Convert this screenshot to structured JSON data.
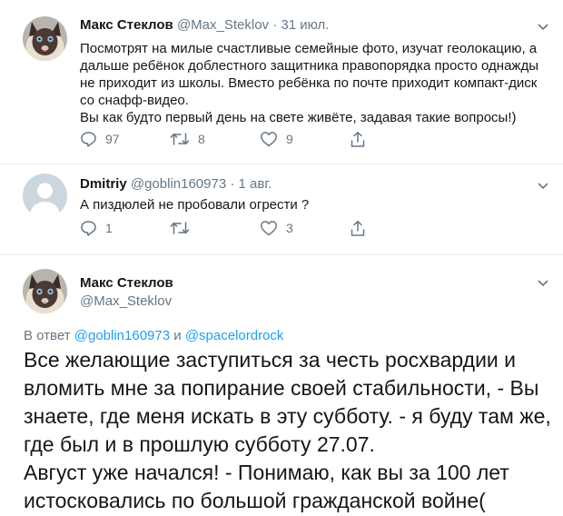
{
  "tweet1": {
    "name": "Макс Стеклов",
    "handle": "@Max_Steklov",
    "dot": "·",
    "date": "31 июл.",
    "lines": [
      "Посмотрят на милые счастливые семейные фото, изучат геолокацию, а",
      "дальше ребёнок доблестного защитника правопорядка просто однажды",
      "не приходит из школы. Вместо ребёнка по почте приходит компакт-диск",
      "со снафф-видео.",
      "Вы как будто первый день на свете живёте, задавая такие вопросы!)"
    ],
    "replies": "97",
    "retweets": "8",
    "likes": "9"
  },
  "tweet2": {
    "name": "Dmitriy",
    "handle": "@goblin160973",
    "dot": "·",
    "date": "1 авг.",
    "text": "А пиздюлей не пробовали огрести ?",
    "replies": "1",
    "retweets": "",
    "likes": "3"
  },
  "tweet3": {
    "name": "Макс Стеклов",
    "handle": "@Max_Steklov",
    "reply_prefix": "В ответ",
    "reply_user1": "@goblin160973",
    "reply_and": "и",
    "reply_user2": "@spacelordrock",
    "lines": [
      "Все желающие заступиться за честь росхвардии и",
      "вломить мне за попирание своей стабильности, - Вы",
      "знаете, где меня искать в эту субботу. - я буду там же,",
      "где был и в прошлую субботу 27.07.",
      "Август уже начался! - Понимаю, как вы за 100 лет",
      "истосковались по большой гражданской войне("
    ]
  },
  "icons": {
    "reply": "reply-icon",
    "retweet": "retweet-icon",
    "like": "heart-icon",
    "share": "share-icon",
    "more": "chevron-down-icon"
  },
  "colors": {
    "text": "#14171a",
    "meta": "#657786",
    "link": "#1da1f2",
    "divider": "#e6ecf0"
  }
}
